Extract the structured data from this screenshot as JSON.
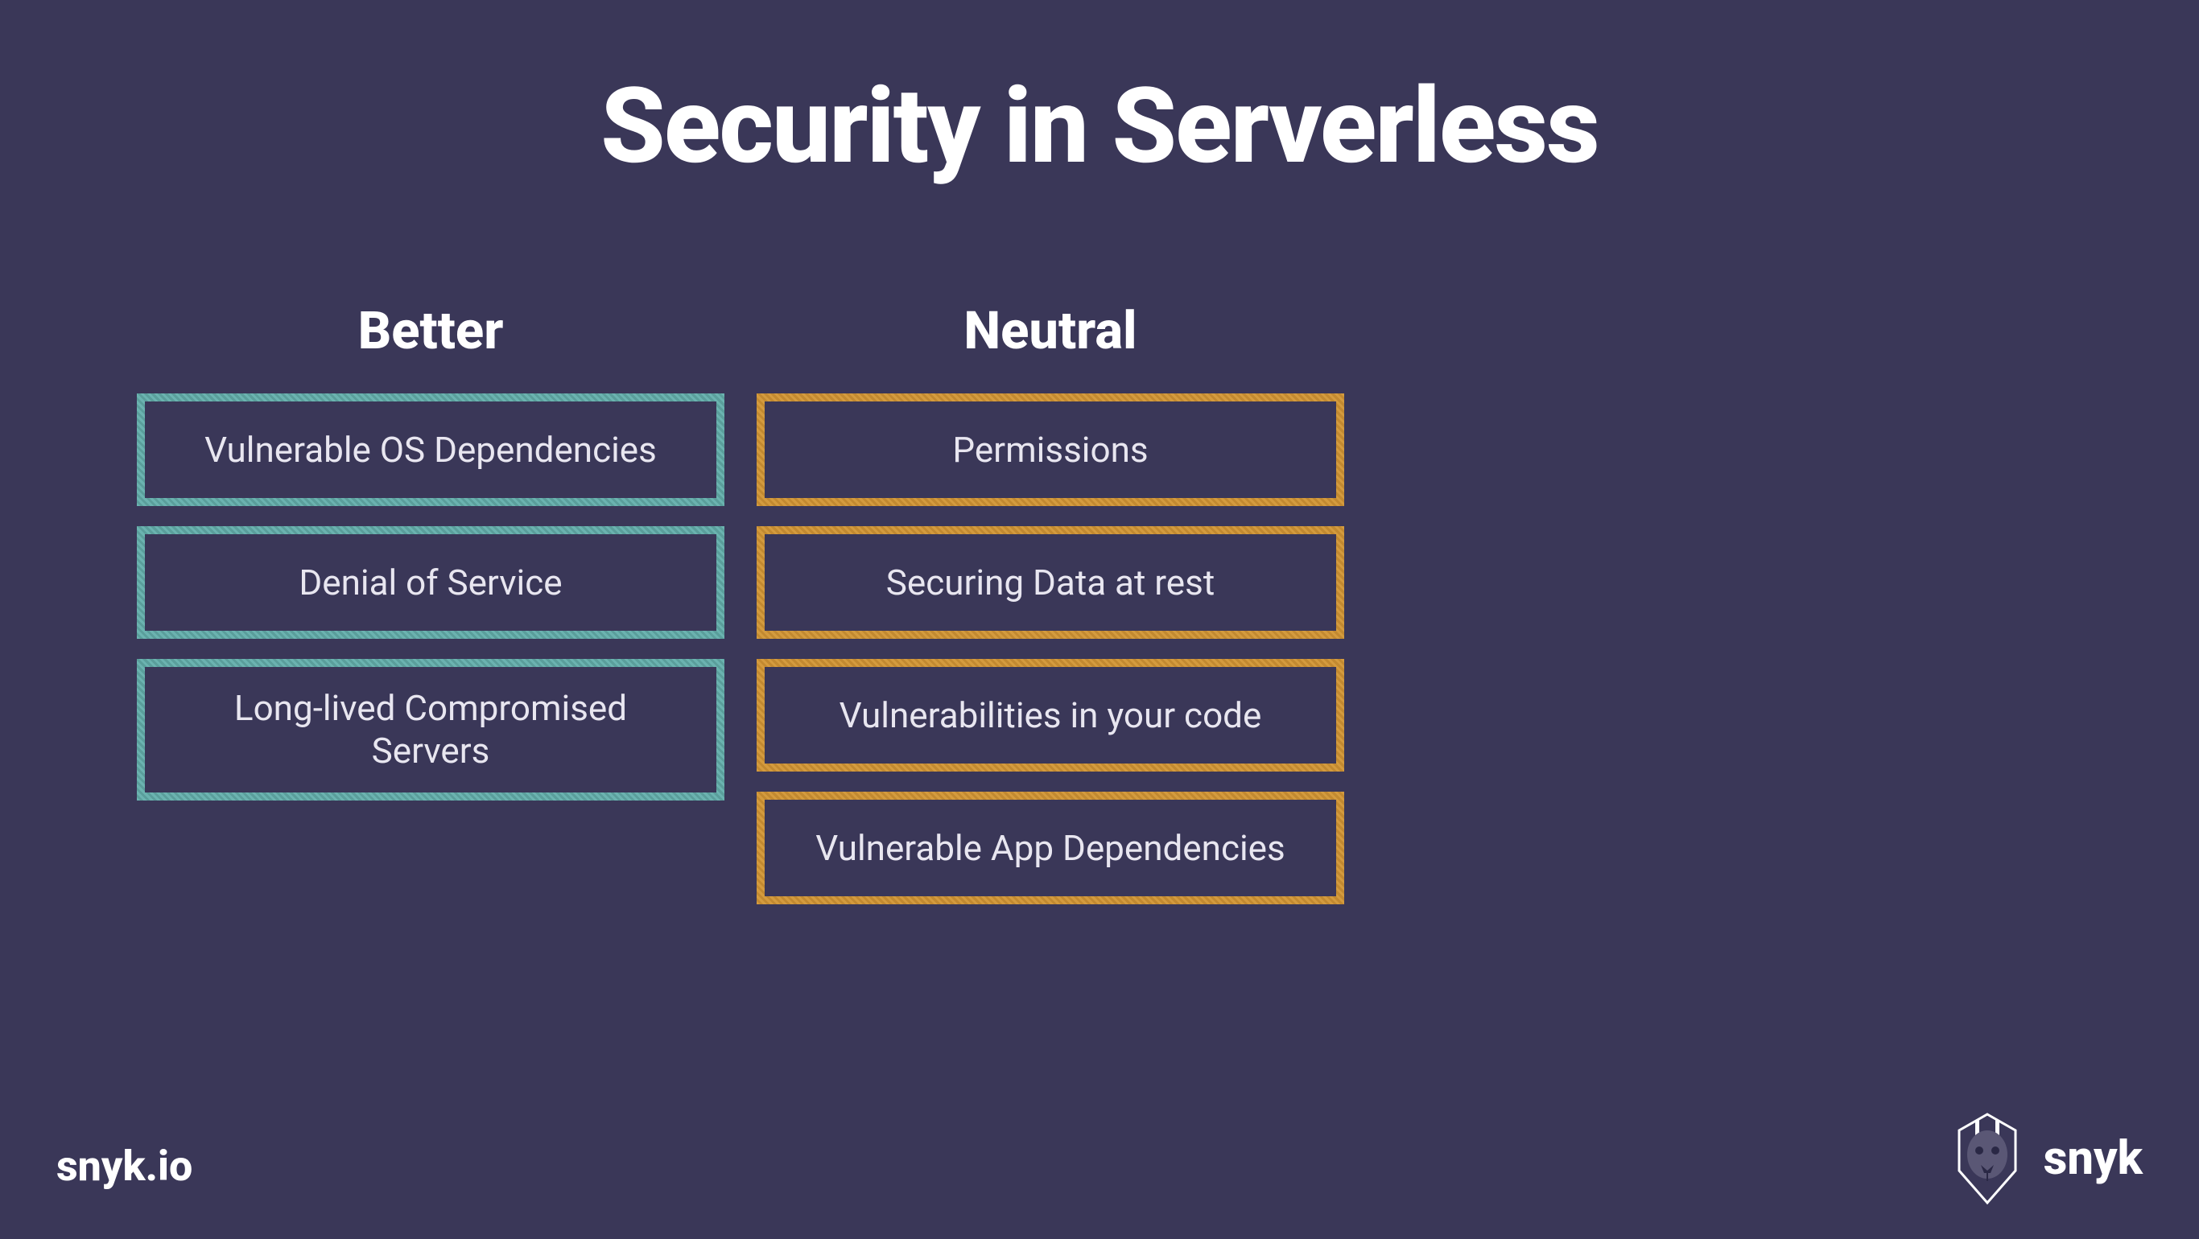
{
  "title": "Security in Serverless",
  "columns": {
    "better": {
      "header": "Better",
      "items": [
        "Vulnerable OS Dependencies",
        "Denial of Service",
        "Long-lived Compromised Servers"
      ]
    },
    "neutral": {
      "header": "Neutral",
      "items": [
        "Permissions",
        "Securing Data at rest",
        "Vulnerabilities in your code",
        "Vulnerable App Dependencies"
      ]
    }
  },
  "footer": {
    "left": "snyk.io",
    "right": "snyk"
  }
}
